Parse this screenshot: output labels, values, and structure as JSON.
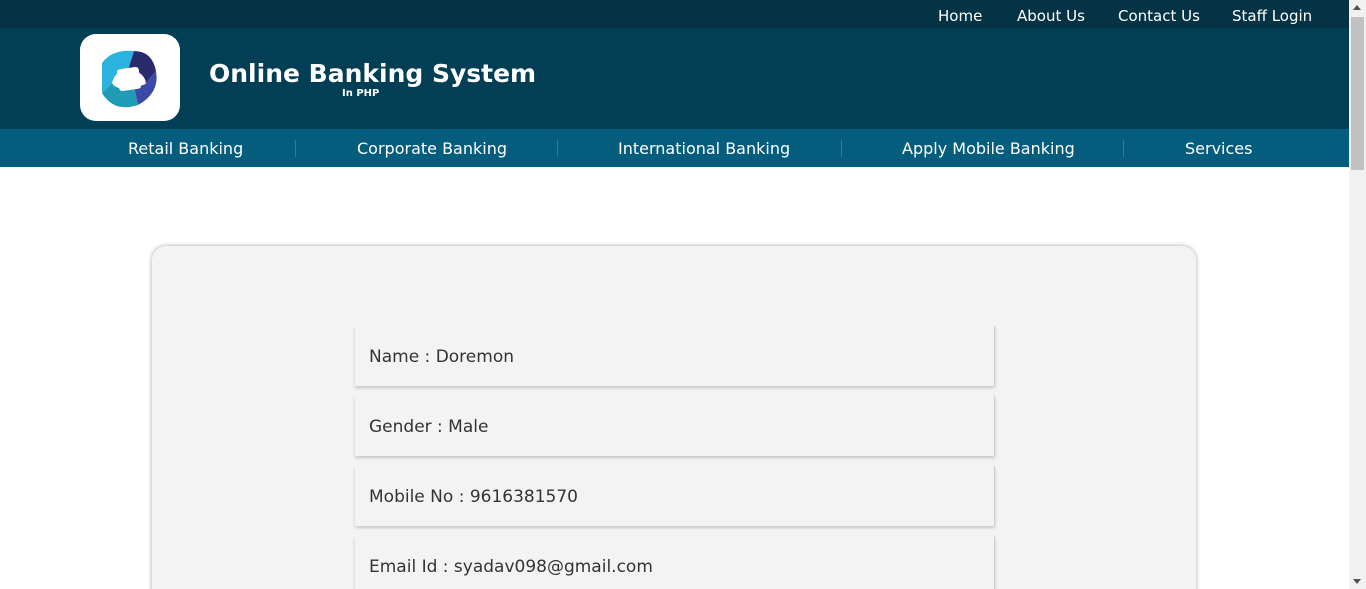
{
  "topbar": {
    "links": [
      "Home",
      "About Us",
      "Contact Us",
      "Staff Login"
    ]
  },
  "header": {
    "logo_icon": "bank-logo-icon",
    "title": "Online Banking System",
    "subtitle": "In PHP"
  },
  "nav": {
    "items": [
      "Retail Banking",
      "Corporate Banking",
      "International Banking",
      "Apply Mobile Banking",
      "Services"
    ]
  },
  "profile": {
    "fields": [
      "Name : Doremon",
      "Gender : Male",
      "Mobile No : 9616381570",
      "Email Id : syadav098@gmail.com"
    ]
  },
  "colors": {
    "topbar": "#053346",
    "header": "#023e54",
    "nav": "#055d7d",
    "card": "#f3f3f3"
  }
}
